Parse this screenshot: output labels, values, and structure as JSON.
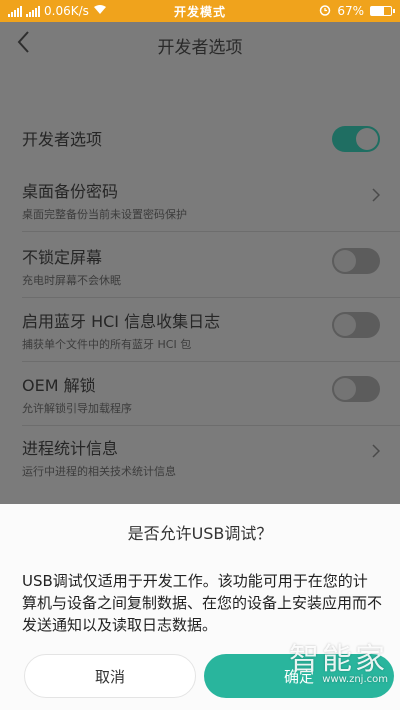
{
  "status_bar": {
    "network_speed": "0.06K/s",
    "mode": "开发模式",
    "battery": "67%",
    "battery_level": 0.67
  },
  "header": {
    "title": "开发者选项"
  },
  "settings": {
    "developer_options": {
      "label": "开发者选项",
      "enabled": true
    },
    "desktop_backup_password": {
      "label": "桌面备份密码",
      "sub": "桌面完整备份当前未设置密码保护"
    },
    "stay_awake": {
      "label": "不锁定屏幕",
      "sub": "充电时屏幕不会休眠",
      "enabled": false
    },
    "bluetooth_hci_log": {
      "label": "启用蓝牙 HCI 信息收集日志",
      "sub": "捕获单个文件中的所有蓝牙 HCI 包",
      "enabled": false
    },
    "oem_unlock": {
      "label": "OEM 解锁",
      "sub": "允许解锁引导加载程序",
      "enabled": false
    },
    "process_stats": {
      "label": "进程统计信息",
      "sub": "运行中进程的相关技术统计信息"
    }
  },
  "dialog": {
    "title": "是否允许USB调试？",
    "body": "USB调试仅适用于开发工作。该功能可用于在您的计算机与设备之间复制数据、在您的设备上安装应用而不发送通知以及读取日志数据。",
    "cancel_label": "取消",
    "ok_label": "确定"
  },
  "watermark": {
    "text": "智能家",
    "url": "www.znj.com"
  }
}
